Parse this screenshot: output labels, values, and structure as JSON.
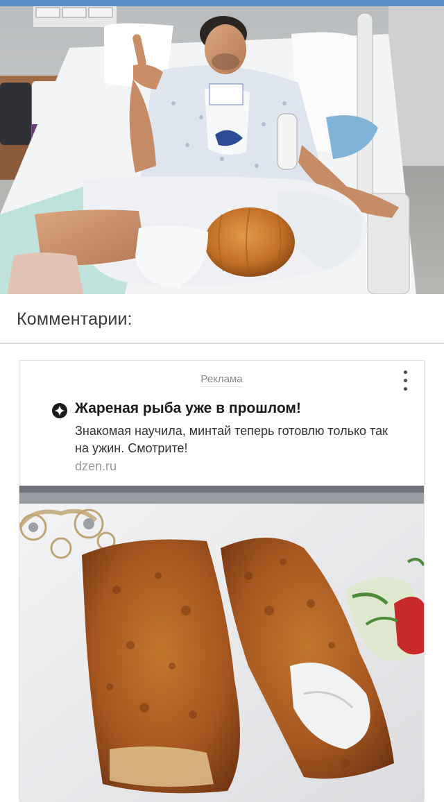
{
  "article": {
    "image_icon": "hospital-patient-photo"
  },
  "comments": {
    "heading": "Комментарии:"
  },
  "ad": {
    "label": "Реклама",
    "menu_icon": "more-vertical-icon",
    "logo_icon": "zen-logo-icon",
    "headline": "Жареная рыба уже в прошлом!",
    "body": "Знакомая научила, минтай теперь готовлю только так на ужин. Смотрите!",
    "domain": "dzen.ru",
    "image_icon": "fried-fish-photo"
  },
  "colors": {
    "top_bar": "#5b8fc7",
    "divider": "#d9d9d9",
    "ad_label": "#8a8a8a",
    "domain": "#9a9a9a"
  }
}
